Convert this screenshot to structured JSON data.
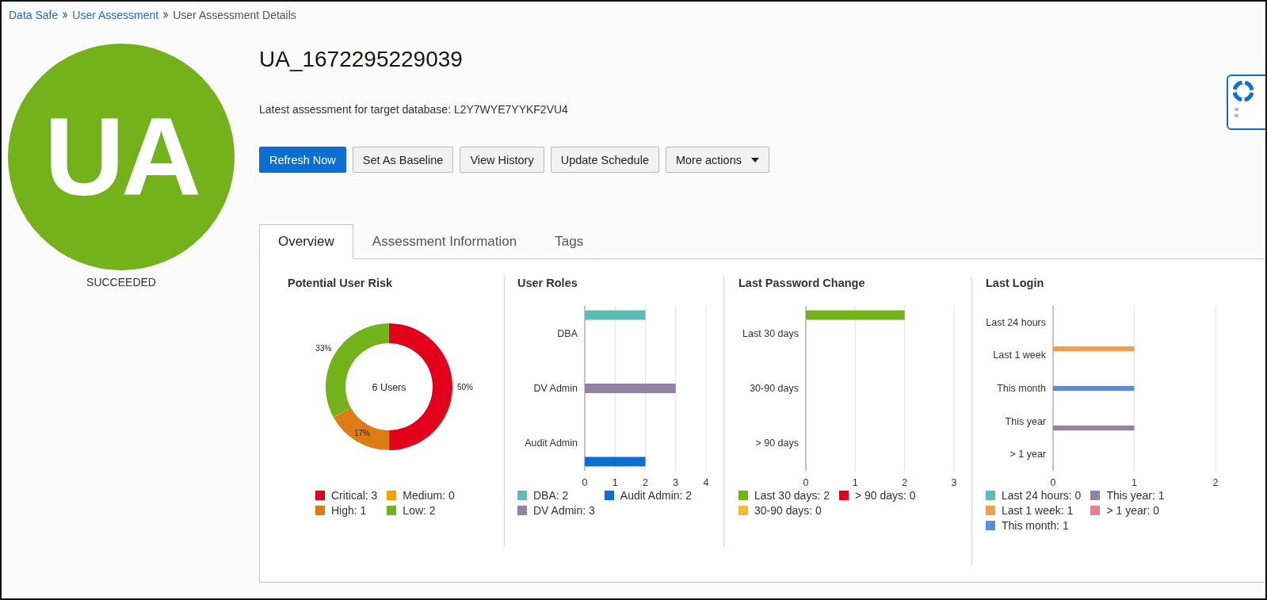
{
  "breadcrumb": [
    {
      "label": "Data Safe",
      "link": true
    },
    {
      "label": "User Assessment",
      "link": true
    },
    {
      "label": "User Assessment Details",
      "link": false
    }
  ],
  "avatar": {
    "initials": "UA",
    "status": "SUCCEEDED"
  },
  "title": "UA_1672295229039",
  "subtitle": "Latest assessment for target database: L2Y7WYE7YYKF2VU4",
  "buttons": [
    {
      "label": "Refresh Now",
      "kind": "primary"
    },
    {
      "label": "Set As Baseline",
      "kind": "plain"
    },
    {
      "label": "View History",
      "kind": "plain"
    },
    {
      "label": "Update Schedule",
      "kind": "plain"
    },
    {
      "label": "More actions",
      "kind": "menu"
    }
  ],
  "tabs": [
    {
      "label": "Overview",
      "selected": true
    },
    {
      "label": "Assessment Information",
      "selected": false
    },
    {
      "label": "Tags",
      "selected": false
    }
  ],
  "panels": [
    {
      "title": "Potential User Risk",
      "center_label": "6 Users",
      "chart_data": {
        "type": "donut",
        "categories": [
          "Critical: 3",
          "High: 1",
          "Medium: 0",
          "Low: 2"
        ],
        "values": [
          50,
          17,
          0,
          33
        ],
        "colors": [
          "#e2001a",
          "#dd7c14",
          "#f5a300",
          "#74b21b"
        ],
        "value_labels": [
          "50%",
          "17%",
          null,
          "33%"
        ],
        "legend": "bottom"
      }
    },
    {
      "title": "User Roles",
      "chart_data": {
        "type": "bar",
        "orientation": "horizontal",
        "categories": [
          "DBA",
          "DV Admin",
          "Audit Admin"
        ],
        "xlim": [
          0,
          4
        ],
        "xticks": [
          0,
          1,
          2,
          3,
          4
        ],
        "grid": true,
        "legend": "bottom",
        "series": [
          {
            "name": "DBA: 2",
            "color": "#5fbcb5",
            "values": [
              2,
              null,
              null
            ]
          },
          {
            "name": "DV Admin: 3",
            "color": "#9580a8",
            "values": [
              null,
              3,
              null
            ]
          },
          {
            "name": "Audit Admin: 2",
            "color": "#0c6fd0",
            "values": [
              null,
              null,
              2
            ]
          }
        ]
      }
    },
    {
      "title": "Last Password Change",
      "chart_data": {
        "type": "bar",
        "orientation": "horizontal",
        "categories": [
          "Last 30 days",
          "30-90 days",
          "> 90 days"
        ],
        "xlim": [
          0,
          3
        ],
        "xticks": [
          0,
          1,
          2,
          3
        ],
        "grid": true,
        "legend": "bottom",
        "series": [
          {
            "name": "Last 30 days: 2",
            "color": "#74b21b",
            "values": [
              2,
              null,
              null
            ]
          },
          {
            "name": "30-90 days: 0",
            "color": "#f5b93a",
            "values": [
              null,
              0,
              null
            ]
          },
          {
            "name": "> 90 days: 0",
            "color": "#e2001a",
            "values": [
              null,
              null,
              0
            ]
          }
        ]
      }
    },
    {
      "title": "Last Login",
      "chart_data": {
        "type": "bar",
        "orientation": "horizontal",
        "categories": [
          "Last 24 hours",
          "Last 1 week",
          "This month",
          "This year",
          "> 1 year"
        ],
        "xlim": [
          0,
          2
        ],
        "xticks": [
          0,
          1,
          2
        ],
        "grid": true,
        "legend": "bottom",
        "series": [
          {
            "name": "Last 24 hours: 0",
            "color": "#5fbcb5",
            "values": [
              0,
              null,
              null,
              null,
              null
            ]
          },
          {
            "name": "Last 1 week: 1",
            "color": "#eda04f",
            "values": [
              null,
              1,
              null,
              null,
              null
            ]
          },
          {
            "name": "This month: 1",
            "color": "#5a8dd8",
            "values": [
              null,
              null,
              1,
              null,
              null
            ]
          },
          {
            "name": "This year: 1",
            "color": "#9580a8",
            "values": [
              null,
              null,
              null,
              1,
              null
            ]
          },
          {
            "name": "> 1 year: 0",
            "color": "#ee7f8f",
            "values": [
              null,
              null,
              null,
              null,
              0
            ]
          }
        ]
      }
    }
  ]
}
